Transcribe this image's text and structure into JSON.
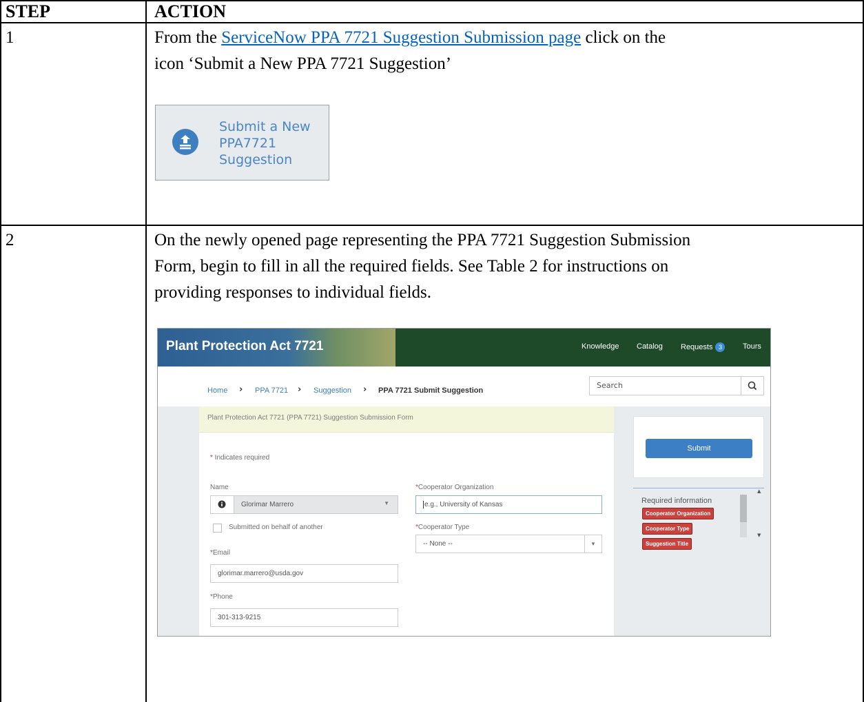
{
  "table": {
    "headers": {
      "step": "STEP",
      "action": "ACTION"
    },
    "rows": [
      {
        "step": "1",
        "text_before_link": "From the ",
        "link_text": "ServiceNow PPA 7721 Suggestion Submission page",
        "text_after_link": " click on the",
        "line2": "icon ‘Submit a New PPA 7721 Suggestion’",
        "tile": {
          "icon": "upload-stack-icon",
          "lines": [
            "Submit a New",
            "PPA7721",
            "Suggestion"
          ]
        }
      },
      {
        "step": "2",
        "lines": [
          "On the newly opened page representing the PPA 7721 Suggestion Submission",
          "Form, begin to fill in all the required fields. See Table 2 for instructions on",
          "providing responses to individual fields."
        ]
      }
    ]
  },
  "screenshot": {
    "brand": "Plant Protection Act 7721",
    "nav": [
      "Knowledge",
      "Catalog",
      "Requests",
      "Tours"
    ],
    "requests_badge": "3",
    "breadcrumb": [
      "Home",
      "PPA 7721",
      "Suggestion",
      "PPA 7721 Submit Suggestion"
    ],
    "search_placeholder": "Search",
    "form_title": "Plant Protection Act 7721 (PPA 7721) Suggestion Submission Form",
    "required_note": "Indicates required",
    "name_label": "Name",
    "name_value": "Glorimar Marrero",
    "behalf_label": "Submitted on behalf of another",
    "email_label": "Email",
    "email_value": "glorimar.marrero@usda.gov",
    "phone_label": "Phone",
    "phone_value": "301-313-9215",
    "org_label": "Cooperator Organization",
    "org_placeholder": "e.g., University of Kansas",
    "type_label": "Cooperator Type",
    "type_value": "-- None --",
    "submit_label": "Submit",
    "required_info_title": "Required information",
    "required_tags": [
      "Cooperator Organization",
      "Cooperator Type",
      "Suggestion Title"
    ],
    "colors": {
      "topbar": "#1f4a2a",
      "accent": "#3d7fc4",
      "tag": "#c9423e",
      "link": "#0563c1"
    }
  }
}
